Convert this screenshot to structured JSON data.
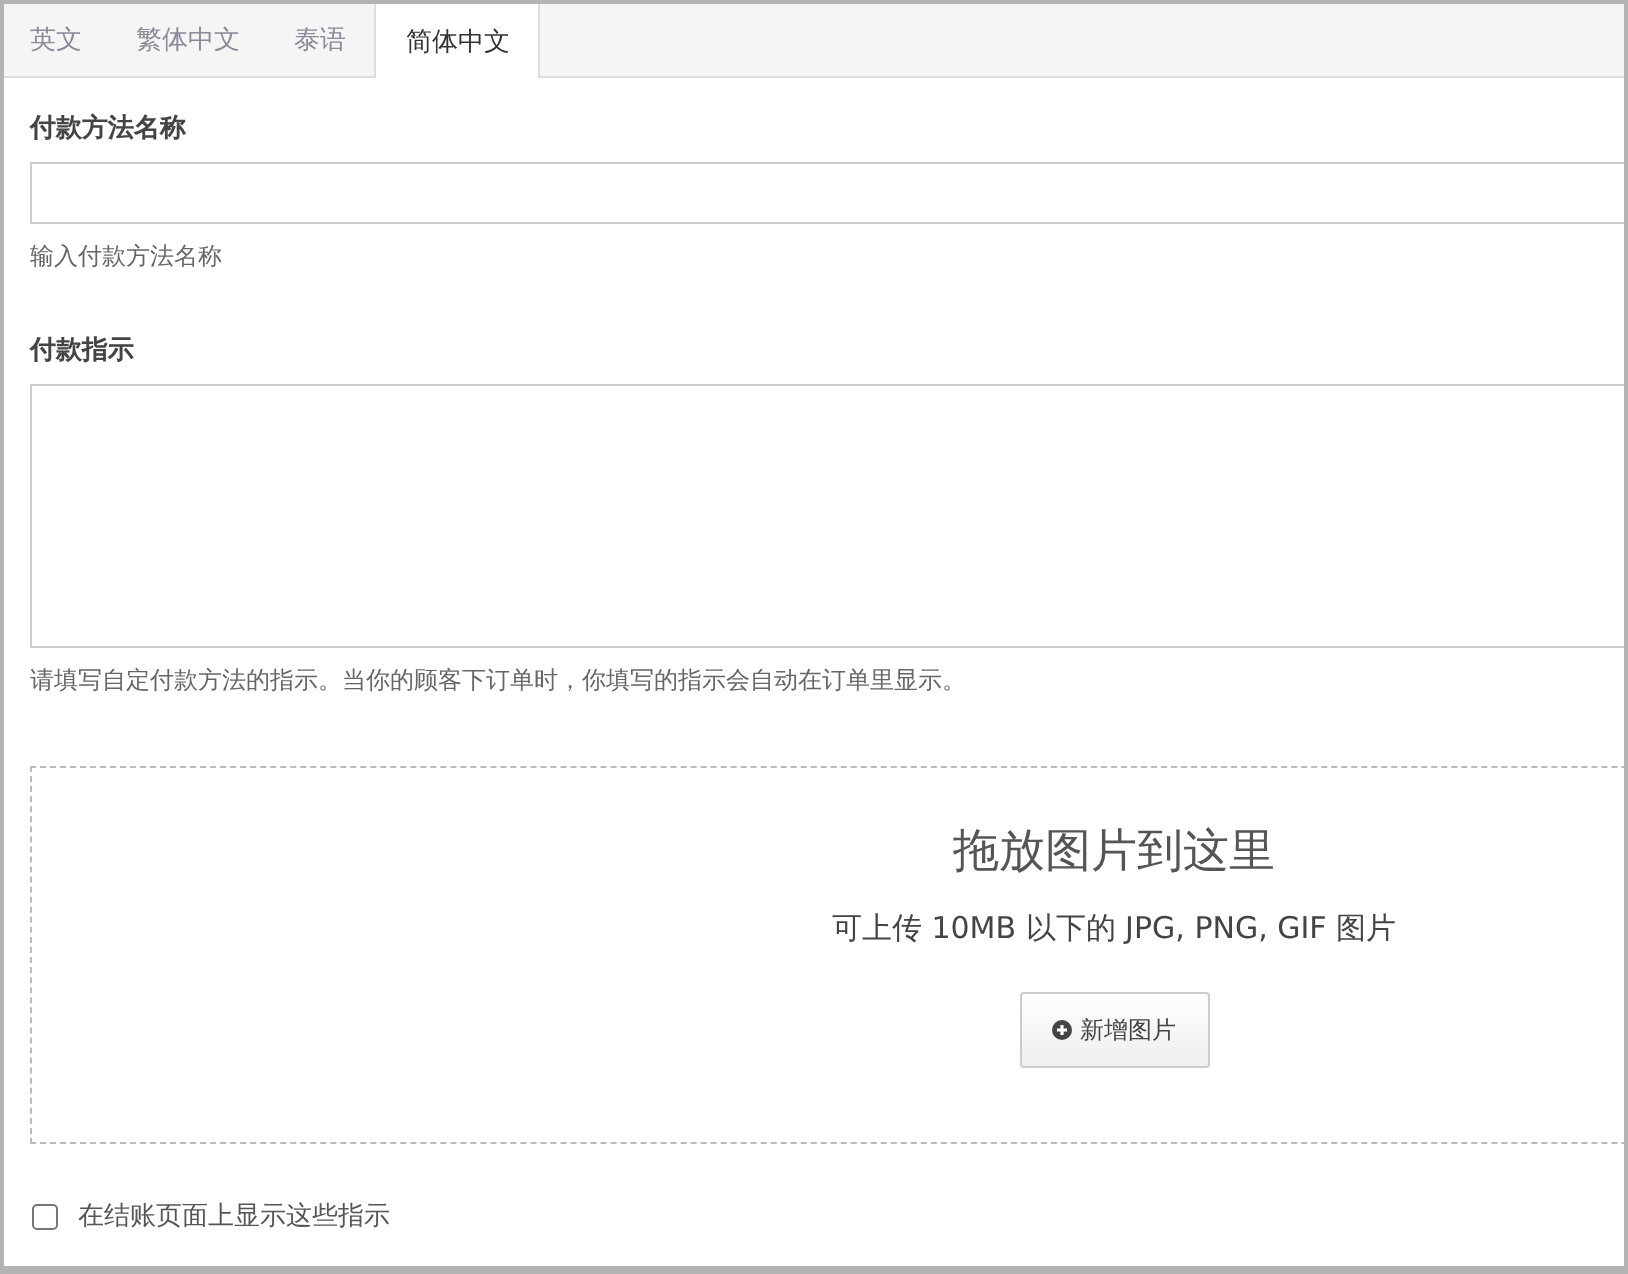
{
  "tabs": [
    {
      "label": "英文",
      "selected": false
    },
    {
      "label": "繁体中文",
      "selected": false
    },
    {
      "label": "泰语",
      "selected": false
    },
    {
      "label": "简体中文",
      "selected": true
    }
  ],
  "name_field": {
    "label": "付款方法名称",
    "help": "输入付款方法名称"
  },
  "instructions_field": {
    "label": "付款指示",
    "help": "请填写自定付款方法的指示。当你的顾客下订单时，你填写的指示会自动在订单里显示。"
  },
  "dropzone": {
    "title": "拖放图片到这里",
    "subtitle": "可上传 10MB 以下的 JPG, PNG, GIF 图片",
    "button": "新增图片"
  },
  "checkbox": {
    "label": "在结账页面上显示这些指示",
    "checked": false
  }
}
